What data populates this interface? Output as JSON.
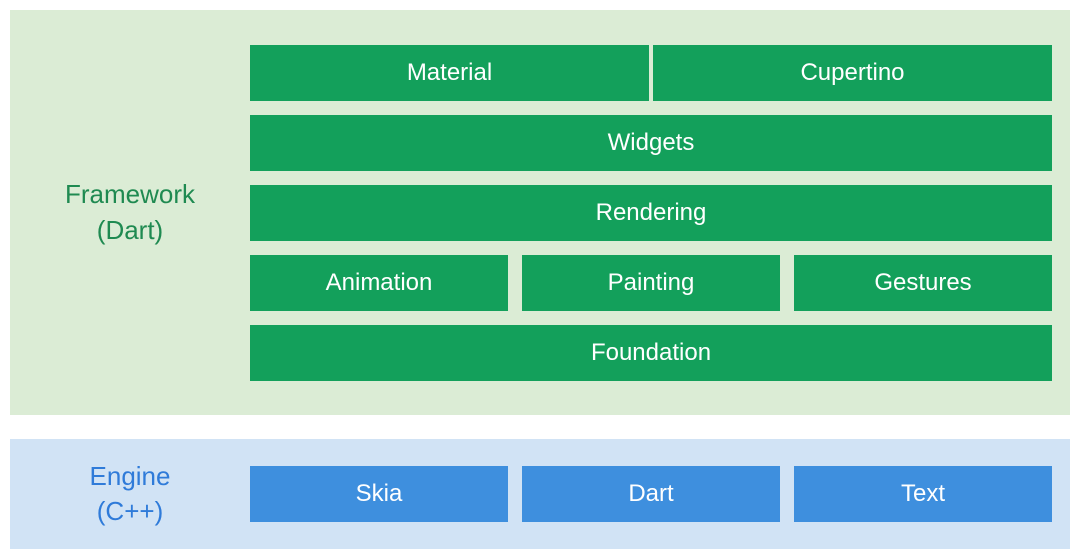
{
  "framework": {
    "label_line1": "Framework",
    "label_line2": "(Dart)",
    "rows": [
      {
        "gap": "tight",
        "blocks": [
          "Material",
          "Cupertino"
        ]
      },
      {
        "gap": "normal",
        "blocks": [
          "Widgets"
        ]
      },
      {
        "gap": "normal",
        "blocks": [
          "Rendering"
        ]
      },
      {
        "gap": "normal",
        "blocks": [
          "Animation",
          "Painting",
          "Gestures"
        ]
      },
      {
        "gap": "normal",
        "blocks": [
          "Foundation"
        ]
      }
    ]
  },
  "engine": {
    "label_line1": "Engine",
    "label_line2": "(C++)",
    "rows": [
      {
        "gap": "normal",
        "blocks": [
          "Skia",
          "Dart",
          "Text"
        ]
      }
    ]
  },
  "colors": {
    "framework_bg": "#dbecd5",
    "framework_block": "#13a05b",
    "framework_text": "#1f8a51",
    "engine_bg": "#d1e3f5",
    "engine_block": "#3e8fde",
    "engine_text": "#2f7bd9"
  }
}
